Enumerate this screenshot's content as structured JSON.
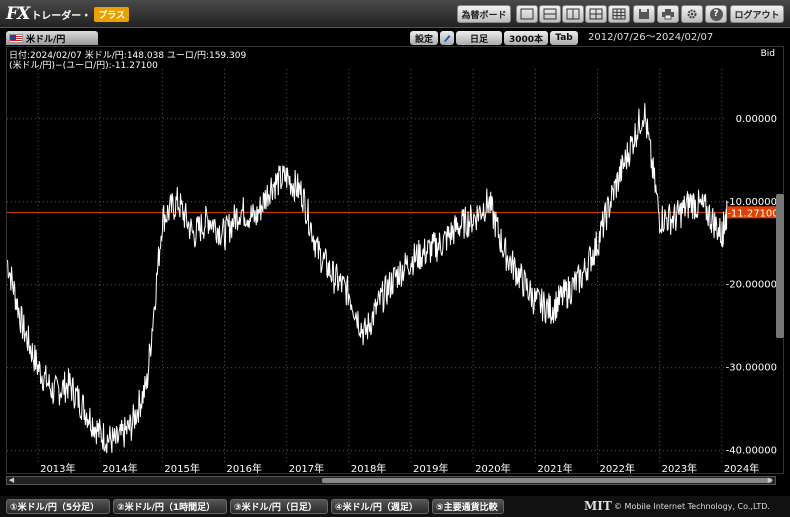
{
  "logo": {
    "fx": "FX",
    "trader": "トレーダー・",
    "plus": "プラス"
  },
  "toolbar": {
    "rate_board": "為替ボード",
    "logout": "ログアウト",
    "help": "?"
  },
  "chart_header": {
    "pair_tab": "米ドル/円",
    "settings": "設定",
    "timeframe": "日足",
    "bars": "3000本",
    "tab": "Tab",
    "date_range": "2012/07/26～2024/02/07"
  },
  "info": {
    "line1": "日付:2024/02/07 米ドル/円:148.038 ユーロ/円:159.309",
    "line2": "(米ドル/円)−(ユーロ/円):-11.27100",
    "bid": "Bid",
    "current_label": "-11.27100"
  },
  "bottom_tabs": [
    "①米ドル/円（5分足）",
    "②米ドル/円（1時間足）",
    "③米ドル/円（日足）",
    "④米ドル/円（週足）",
    "⑤主要通貨比較"
  ],
  "footer": {
    "logo": "MIT",
    "copyright": "© Mobile Internet Technology, Co.,LTD."
  },
  "colors": {
    "line": "#ffffff",
    "current": "#e04000",
    "grid": "#555555"
  },
  "chart_data": {
    "type": "line",
    "series": [
      {
        "name": "(米ドル/円)−(ユーロ/円)",
        "x": [
          "2012/07",
          "2012/10",
          "2013/01",
          "2013/04",
          "2013/07",
          "2013/10",
          "2014/01",
          "2014/04",
          "2014/07",
          "2014/10",
          "2015/01",
          "2015/04",
          "2015/07",
          "2015/10",
          "2016/01",
          "2016/04",
          "2016/07",
          "2016/10",
          "2017/01",
          "2017/04",
          "2017/07",
          "2017/10",
          "2018/01",
          "2018/04",
          "2018/07",
          "2018/10",
          "2019/01",
          "2019/04",
          "2019/07",
          "2019/10",
          "2020/01",
          "2020/04",
          "2020/07",
          "2020/10",
          "2021/01",
          "2021/04",
          "2021/07",
          "2021/10",
          "2022/01",
          "2022/04",
          "2022/07",
          "2022/10",
          "2023/01",
          "2023/04",
          "2023/07",
          "2023/10",
          "2024/01",
          "2024/02"
        ],
        "values": [
          -17,
          -25,
          -30,
          -33,
          -32,
          -35,
          -38,
          -39,
          -37,
          -32,
          -12,
          -10,
          -14,
          -12,
          -14,
          -11,
          -12,
          -8,
          -7,
          -9,
          -16,
          -19,
          -21,
          -26,
          -22,
          -19,
          -17,
          -16,
          -15,
          -13,
          -12,
          -10,
          -16,
          -19,
          -22,
          -23,
          -21,
          -19,
          -15,
          -9,
          -4,
          1,
          -12,
          -12,
          -10,
          -11,
          -14,
          -11.271
        ]
      }
    ],
    "y_ticks": [
      "0.00000",
      "-10.00000",
      "-20.00000",
      "-30.00000",
      "-40.00000"
    ],
    "x_ticks": [
      "2013年",
      "2014年",
      "2015年",
      "2016年",
      "2017年",
      "2018年",
      "2019年",
      "2020年",
      "2021年",
      "2022年",
      "2023年",
      "2024年"
    ],
    "ylim": [
      -41,
      6
    ],
    "current_value": -11.271,
    "grid": true
  }
}
